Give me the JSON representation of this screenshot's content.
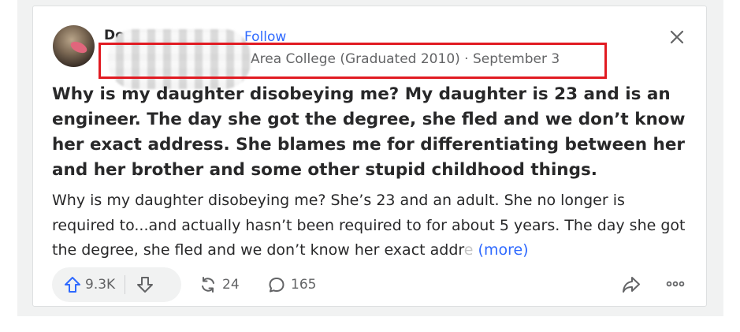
{
  "author": {
    "name": "Do",
    "follow_label": "Follow",
    "credential": "Area College (Graduated 2010) · September 3"
  },
  "question": {
    "title": "Why is my daughter disobeying me? My daughter is 23 and is an engineer. The day she got the degree, she fled and we don’t know her exact address. She blames me for differentiating between her and her brother and some other stupid childhood things."
  },
  "answer": {
    "preview_text": "Why is my daughter disobeying me? She’s 23 and an adult. She no longer is required to...and actually hasn’t been required to for about 5 years. The day she got the degree, she fled and we don’t know her exact addr",
    "preview_fade": "e",
    "more_label": "(more)"
  },
  "actions": {
    "upvotes": "9.3K",
    "shares": "24",
    "comments": "165"
  },
  "icons": [
    "close-icon",
    "upvote-icon",
    "downvote-icon",
    "share-icon",
    "comment-icon",
    "reshare-icon",
    "overflow-icon"
  ],
  "colors": {
    "accent": "#2e69ff",
    "highlight_box": "#e11b22",
    "muted_text": "#636466"
  }
}
